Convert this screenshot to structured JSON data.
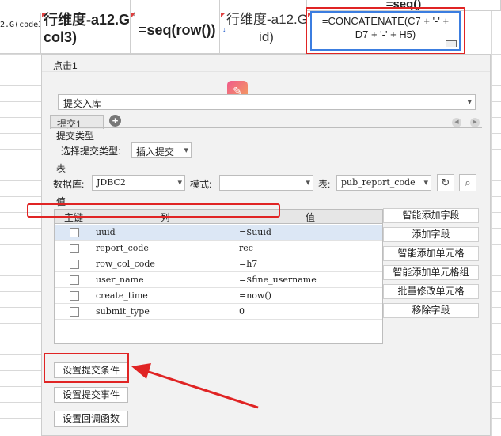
{
  "sheet": {
    "top_cell": "=seq()",
    "cell_a": "2.G(code3",
    "cell_b": "行维度-a12.G(\ncol3)",
    "cell_c": "=seq(row())",
    "cell_d": "行维度-a12.G(\nid)",
    "formula": "=CONCATENATE(C7 + '-' +\nD7 + '-' + H5)"
  },
  "dialog": {
    "title": "点击1",
    "action_type": "提交入库",
    "tab_label": "提交1",
    "section_submit_type": "提交类型",
    "choose_type_label": "选择提交类型:",
    "submit_type_value": "插入提交",
    "section_table": "表",
    "database_label": "数据库:",
    "database_value": "JDBC2",
    "mode_label": "模式:",
    "mode_value": "",
    "table_label": "表:",
    "table_value": "pub_report_code",
    "section_value": "值",
    "columns": {
      "key": "主键",
      "column": "列",
      "value": "值"
    },
    "rows": [
      {
        "column": "uuid",
        "value": "=$uuid"
      },
      {
        "column": "report_code",
        "value": "rec"
      },
      {
        "column": "row_col_code",
        "value": "=h7"
      },
      {
        "column": "user_name",
        "value": "=$fine_username"
      },
      {
        "column": "create_time",
        "value": "=now()"
      },
      {
        "column": "submit_type",
        "value": "0"
      }
    ],
    "side_buttons": [
      "智能添加字段",
      "添加字段",
      "智能添加单元格",
      "智能添加单元格组",
      "批量修改单元格",
      "移除字段"
    ],
    "bottom_buttons": [
      "设置提交条件",
      "设置提交事件",
      "设置回调函数"
    ]
  },
  "colors": {
    "highlight_red": "#e02424",
    "selection_blue": "#3b7de0",
    "row_selected": "#dce7f5"
  }
}
